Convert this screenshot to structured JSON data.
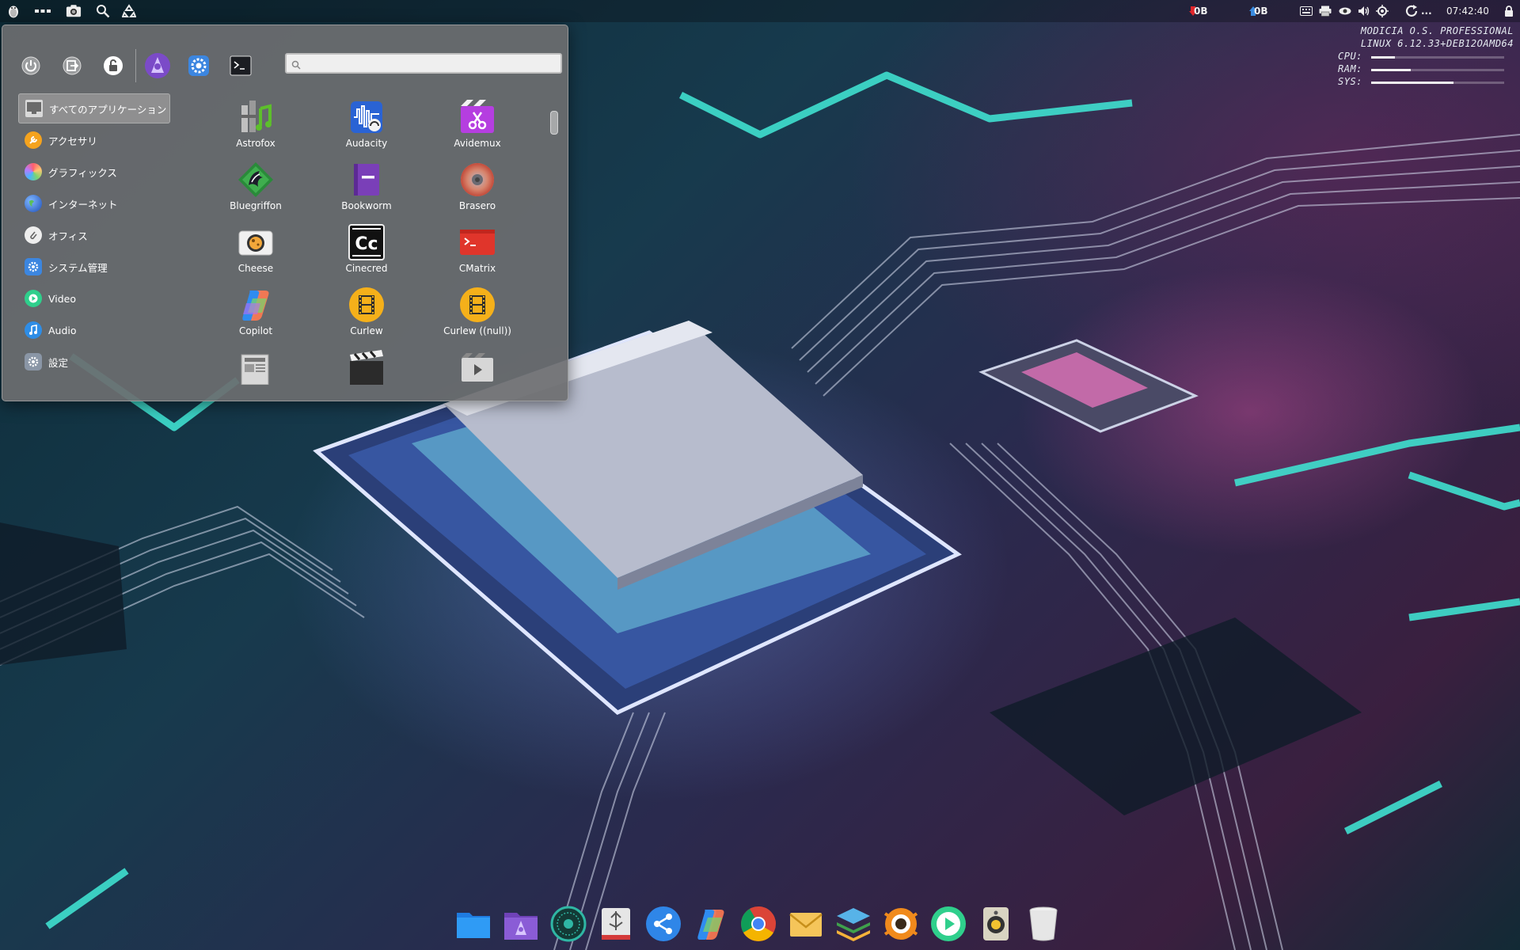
{
  "top_panel": {
    "net_down": "0B",
    "net_up": "0B",
    "updates_label": "...",
    "clock": "07:42:40"
  },
  "conky": {
    "os_name": "MODICIA O.S. PROFESSIONAL",
    "kernel": "LINUX  6.12.33+DEB12OAMD64",
    "cpu_label": "CPU:",
    "ram_label": "RAM:",
    "sys_label": "SYS:",
    "cpu_fraction": 0.18,
    "ram_fraction": 0.3,
    "sys_fraction": 0.62
  },
  "menu": {
    "search_value": "",
    "categories": [
      {
        "label": "すべてのアプリケーション",
        "icon": "monitor-icon",
        "active": true
      },
      {
        "label": "アクセサリ",
        "icon": "accessories-icon"
      },
      {
        "label": "グラフィックス",
        "icon": "graphics-icon"
      },
      {
        "label": "インターネット",
        "icon": "internet-globe-icon"
      },
      {
        "label": "オフィス",
        "icon": "office-clip-icon"
      },
      {
        "label": "システム管理",
        "icon": "system-gear-icon"
      },
      {
        "label": "Video",
        "icon": "video-play-icon"
      },
      {
        "label": "Audio",
        "icon": "audio-note-icon"
      },
      {
        "label": "設定",
        "icon": "settings-icon"
      }
    ],
    "apps": [
      {
        "label": "Astrofox",
        "icon": "astrofox-icon"
      },
      {
        "label": "Audacity",
        "icon": "audacity-icon"
      },
      {
        "label": "Avidemux",
        "icon": "avidemux-icon"
      },
      {
        "label": "Bluegriffon",
        "icon": "bluegriffon-icon"
      },
      {
        "label": "Bookworm",
        "icon": "bookworm-icon"
      },
      {
        "label": "Brasero",
        "icon": "brasero-icon"
      },
      {
        "label": "Cheese",
        "icon": "cheese-icon"
      },
      {
        "label": "Cinecred",
        "icon": "cinecred-icon"
      },
      {
        "label": "CMatrix",
        "icon": "cmatrix-icon"
      },
      {
        "label": "Copilot",
        "icon": "copilot-icon"
      },
      {
        "label": "Curlew",
        "icon": "curlew-icon"
      },
      {
        "label": "Curlew ((null))",
        "icon": "curlew-null-icon"
      }
    ]
  },
  "dock": {
    "items": [
      "files-folder-icon",
      "modicia-home-icon",
      "sphere-app-icon",
      "usb-writer-icon",
      "share-icon",
      "copilot-icon",
      "chrome-browser-icon",
      "mail-icon",
      "layers-icon",
      "xnview-icon",
      "media-player-icon",
      "speaker-icon",
      "trash-icon"
    ]
  }
}
